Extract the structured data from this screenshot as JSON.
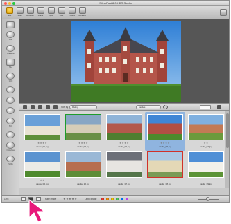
{
  "window": {
    "title": "SilverFast 8.0 HDR Studio"
  },
  "toolbar": {
    "buttons": [
      {
        "label": "Auto"
      },
      {
        "label": "Scan"
      },
      {
        "label": "Autoscan"
      },
      {
        "label": "Frame"
      },
      {
        "label": "Split"
      },
      {
        "label": "Multi"
      },
      {
        "label": "Presets"
      },
      {
        "label": "Workflow"
      }
    ]
  },
  "leftbar": {
    "labels": [
      "",
      "Auto",
      "Gradation",
      "HiLo",
      "GCC",
      "",
      "",
      "",
      "SCC",
      "",
      "NoiseOver",
      "SRDx"
    ]
  },
  "browser": {
    "sort_label": "Sort by",
    "sort_value": "Rating",
    "folder_value": "castles"
  },
  "thumbnails": [
    {
      "name": "castle_01.jpg",
      "stars": "★★★★",
      "border": "white",
      "selected": false
    },
    {
      "name": "castle_04.jpg",
      "stars": "★★★★",
      "border": "green",
      "selected": false
    },
    {
      "name": "castle_03.jpg",
      "stars": "★★★★",
      "border": "white",
      "selected": false
    },
    {
      "name": "castle_06.jpg",
      "stars": "★★★★",
      "border": "white",
      "selected": true
    },
    {
      "name": "castle_02.jpg",
      "stars": "★★",
      "border": "white",
      "selected": false
    },
    {
      "name": "castle_05.jpg",
      "stars": "★★",
      "border": "white",
      "selected": false
    },
    {
      "name": "castle_12.jpg",
      "stars": "",
      "border": "white",
      "selected": false
    },
    {
      "name": "castle_07.jpg",
      "stars": "",
      "border": "white",
      "selected": false
    },
    {
      "name": "castle_08.jpg",
      "stars": "",
      "border": "red",
      "selected": false
    },
    {
      "name": "castle_09.jpg",
      "stars": "",
      "border": "white",
      "selected": false
    }
  ],
  "statusbar": {
    "zoom": "13%",
    "rate_label": "Rate image",
    "rate_stars": "★★★★★",
    "label_label": "Label image"
  },
  "colors": {
    "label_dots": [
      "#ff3b30",
      "#ff9500",
      "#ffcc00",
      "#4cd964",
      "#007aff",
      "#c644fc"
    ],
    "selection": "#8fb4df",
    "cursor": "#e8197a"
  }
}
